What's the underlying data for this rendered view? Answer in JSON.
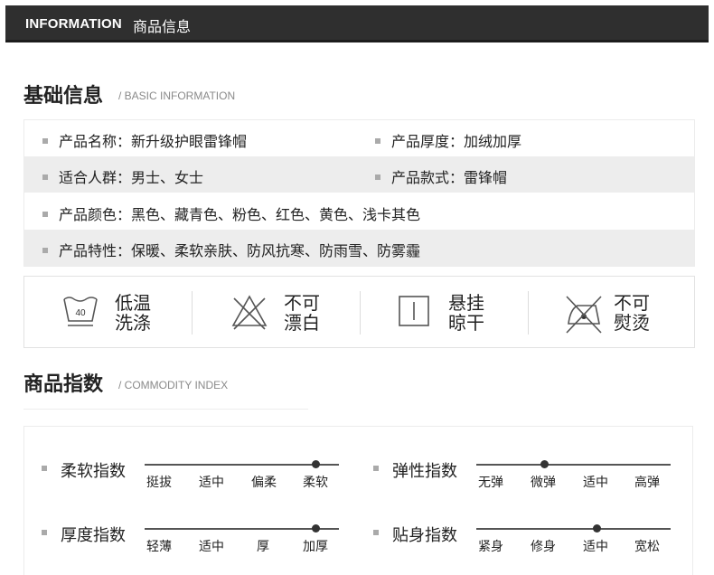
{
  "header": {
    "title_en": "INFORMATION",
    "title_zh": "商品信息"
  },
  "basic": {
    "title": "基础信息",
    "subtitle": "/ BASIC INFORMATION",
    "rows": [
      {
        "shaded": false,
        "items": [
          "产品名称：新升级护眼雷锋帽",
          "产品厚度：加绒加厚"
        ]
      },
      {
        "shaded": true,
        "items": [
          "适合人群：男士、女士",
          "产品款式：雷锋帽"
        ]
      },
      {
        "shaded": false,
        "items": [
          "产品颜色：黑色、藏青色、粉色、红色、黄色、浅卡其色"
        ]
      },
      {
        "shaded": true,
        "items": [
          "产品特性：保暖、柔软亲肤、防风抗寒、防雨雪、防雾霾"
        ]
      }
    ]
  },
  "care": [
    {
      "icon": "wash-40-icon",
      "icon_text": "40",
      "line1": "低温",
      "line2": "洗涤"
    },
    {
      "icon": "no-bleach-icon",
      "line1": "不可",
      "line2": "漂白"
    },
    {
      "icon": "hang-dry-icon",
      "line1": "悬挂",
      "line2": "晾干"
    },
    {
      "icon": "no-iron-icon",
      "line1": "不可",
      "line2": "熨烫"
    }
  ],
  "index": {
    "title": "商品指数",
    "subtitle": "/ COMMODITY INDEX",
    "scales": [
      {
        "label": "柔软指数",
        "options": [
          "挺拔",
          "适中",
          "偏柔",
          "柔软"
        ],
        "selected_position": 0.88
      },
      {
        "label": "弹性指数",
        "options": [
          "无弹",
          "微弹",
          "适中",
          "高弹"
        ],
        "selected_position": 0.35
      },
      {
        "label": "厚度指数",
        "options": [
          "轻薄",
          "适中",
          "厚",
          "加厚"
        ],
        "selected_position": 0.88
      },
      {
        "label": "贴身指数",
        "options": [
          "紧身",
          "修身",
          "适中",
          "宽松"
        ],
        "selected_position": 0.62
      }
    ]
  },
  "colors": {
    "header_bg": "#2f2f2f",
    "row_shade": "#ededed",
    "bullet": "#aaaaaa",
    "scale": "#555555"
  }
}
